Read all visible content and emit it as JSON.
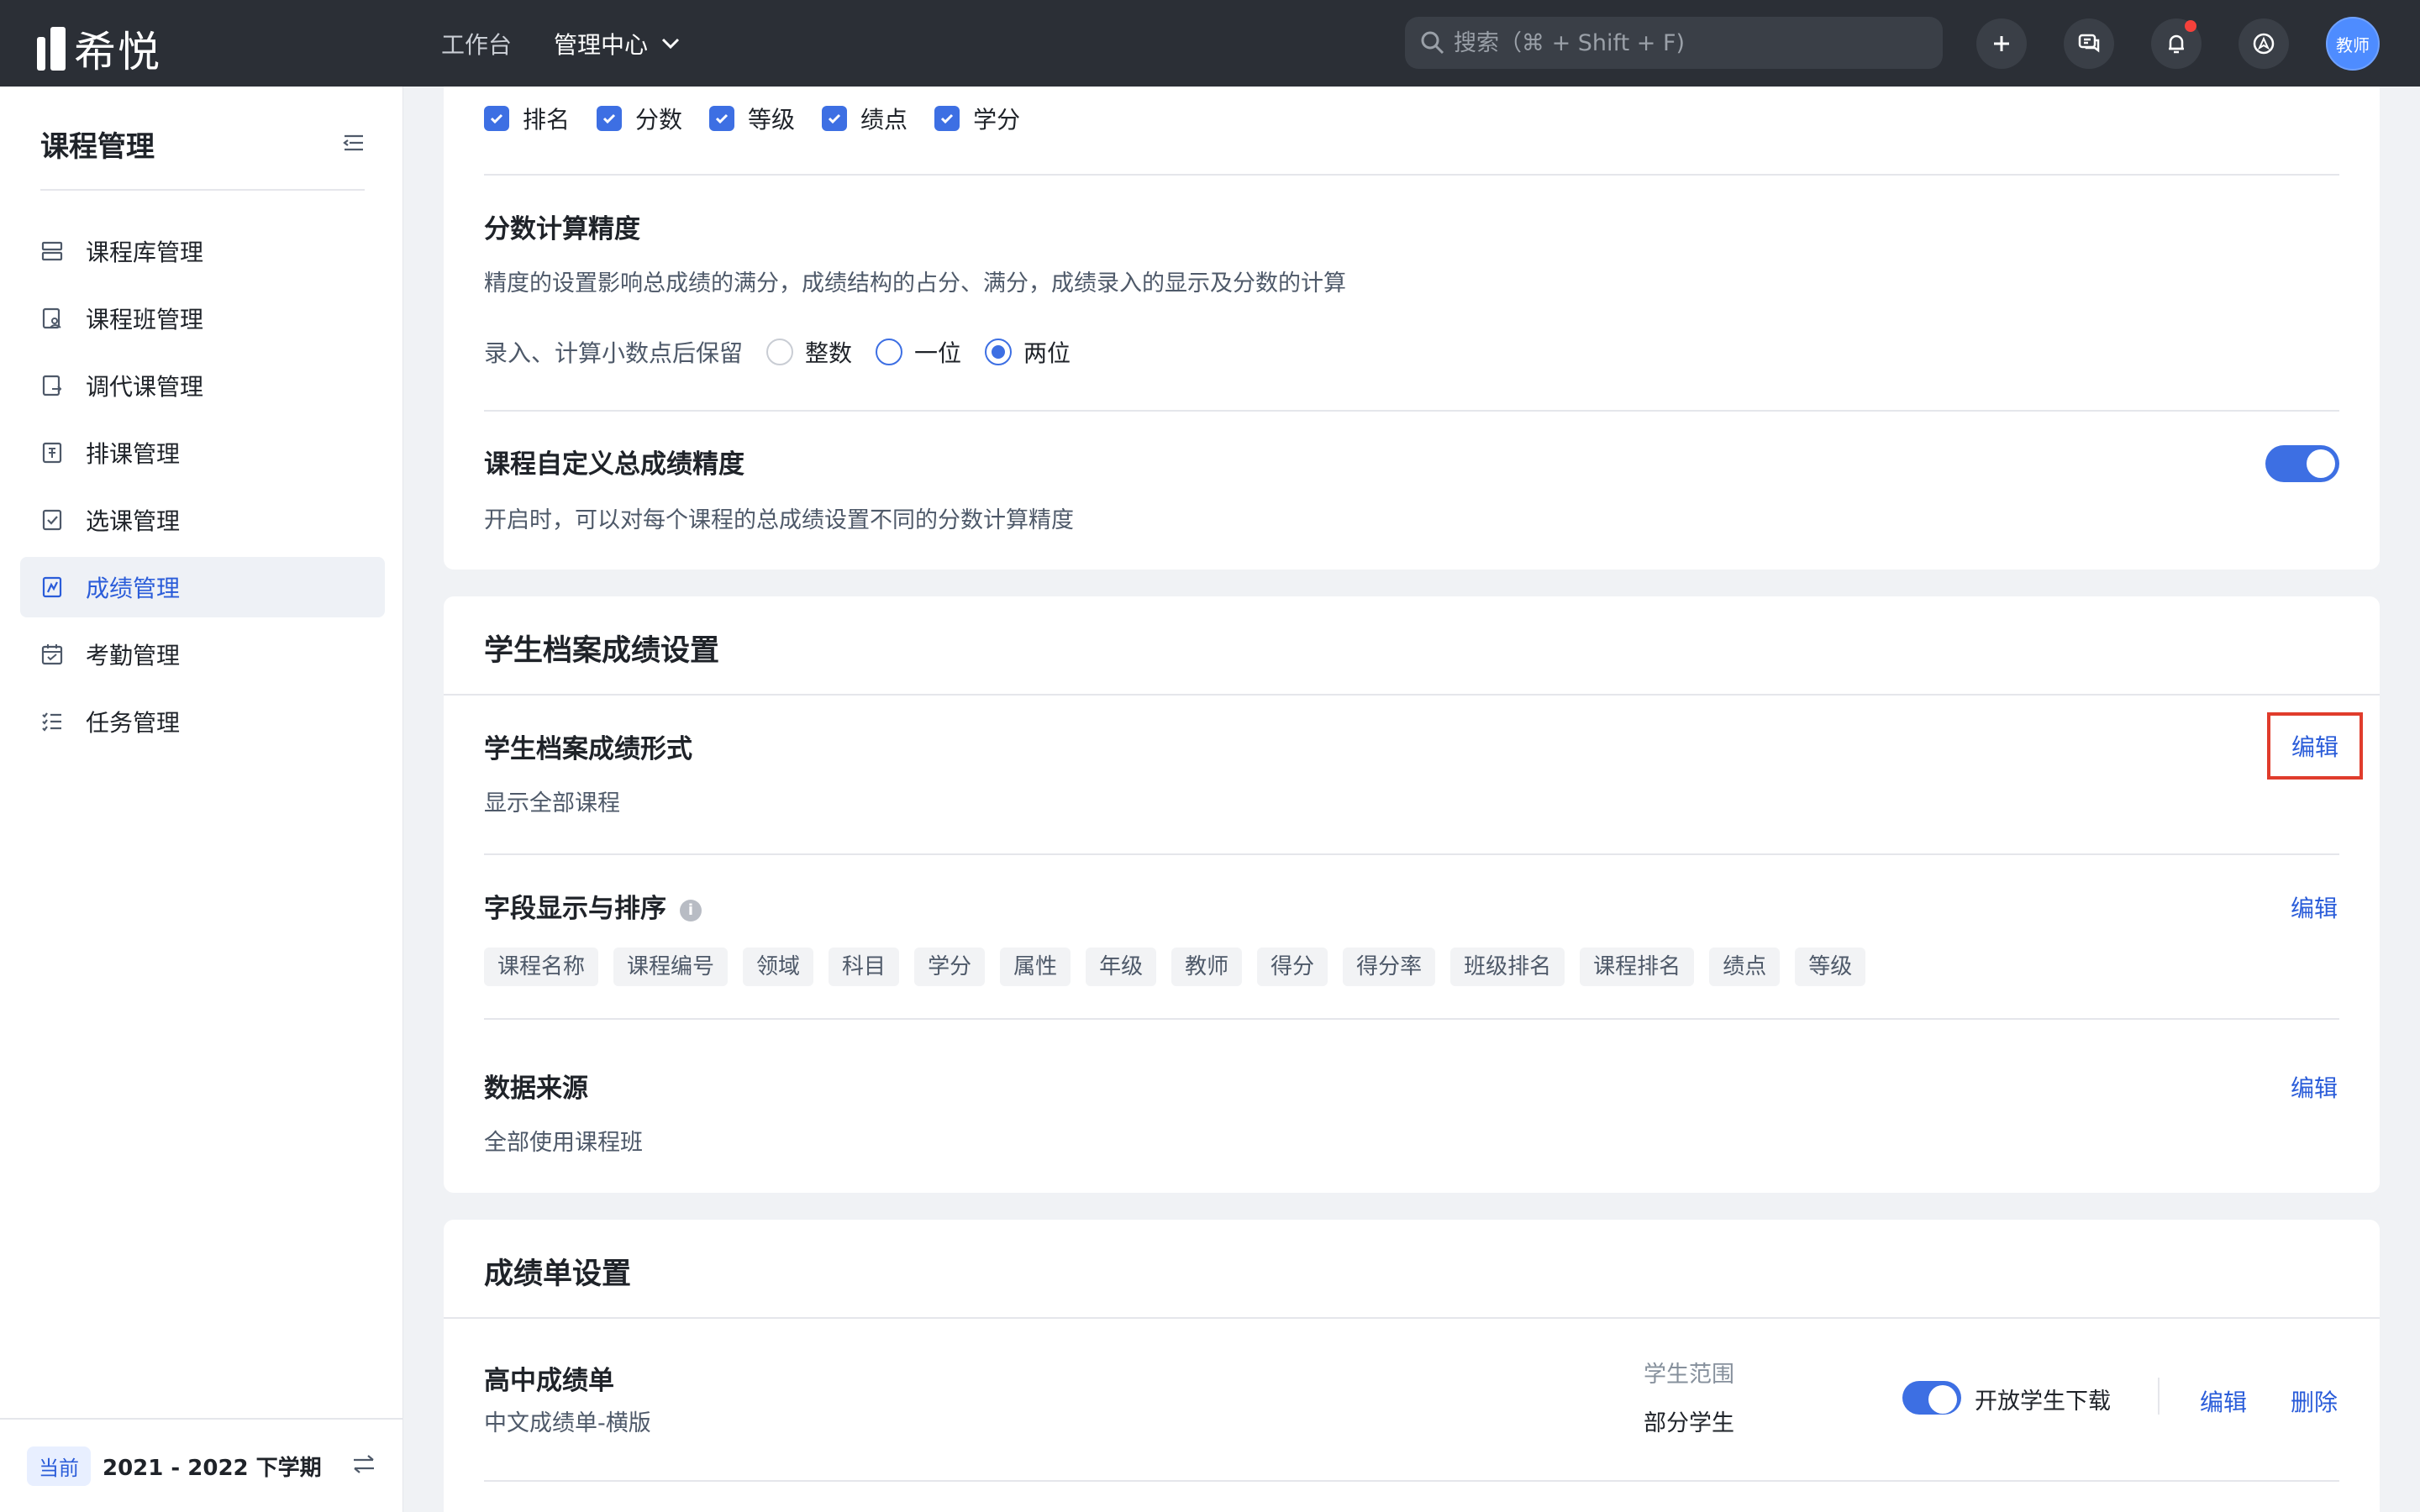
{
  "topbar": {
    "logo_text": "希悦",
    "nav": [
      {
        "label": "工作台"
      },
      {
        "label": "管理中心"
      }
    ],
    "search_placeholder": "搜索（⌘ + Shift + F)",
    "avatar_label": "教师"
  },
  "sidebar": {
    "title": "课程管理",
    "items": [
      {
        "label": "课程库管理",
        "icon": "course-library-icon"
      },
      {
        "label": "课程班管理",
        "icon": "course-class-icon"
      },
      {
        "label": "调代课管理",
        "icon": "substitute-icon"
      },
      {
        "label": "排课管理",
        "icon": "schedule-icon"
      },
      {
        "label": "选课管理",
        "icon": "course-selection-icon"
      },
      {
        "label": "成绩管理",
        "icon": "grades-icon",
        "active": true
      },
      {
        "label": "考勤管理",
        "icon": "attendance-icon"
      },
      {
        "label": "任务管理",
        "icon": "task-list-icon"
      }
    ],
    "footer": {
      "tag": "当前",
      "term": "2021 - 2022 下学期"
    }
  },
  "grade_fields": {
    "checkboxes": [
      {
        "label": "排名",
        "checked": true
      },
      {
        "label": "分数",
        "checked": true
      },
      {
        "label": "等级",
        "checked": true
      },
      {
        "label": "绩点",
        "checked": true
      },
      {
        "label": "学分",
        "checked": true
      }
    ]
  },
  "precision": {
    "title": "分数计算精度",
    "desc": "精度的设置影响总成绩的满分，成绩结构的占分、满分，成绩录入的显示及分数的计算",
    "radio_label": "录入、计算小数点后保留",
    "options": [
      {
        "label": "整数"
      },
      {
        "label": "一位"
      },
      {
        "label": "两位",
        "checked": true
      }
    ]
  },
  "custom_precision": {
    "title": "课程自定义总成绩精度",
    "desc": "开启时，可以对每个课程的总成绩设置不同的分数计算精度",
    "enabled": true
  },
  "archive": {
    "title": "学生档案成绩设置",
    "form": {
      "title": "学生档案成绩形式",
      "value": "显示全部课程",
      "edit": "编辑"
    },
    "fields": {
      "title": "字段显示与排序",
      "edit": "编辑",
      "tags": [
        "课程名称",
        "课程编号",
        "领域",
        "科目",
        "学分",
        "属性",
        "年级",
        "教师",
        "得分",
        "得分率",
        "班级排名",
        "课程排名",
        "绩点",
        "等级"
      ]
    },
    "source": {
      "title": "数据来源",
      "value": "全部使用课程班",
      "edit": "编辑"
    }
  },
  "report": {
    "title": "成绩单设置",
    "item": {
      "name": "高中成绩单",
      "subtitle": "中文成绩单-横版",
      "scope_label": "学生范围",
      "scope_value": "部分学生",
      "download_label": "开放学生下载",
      "download_enabled": true,
      "edit": "编辑",
      "delete": "删除"
    }
  },
  "colors": {
    "accent": "#3d6fe3",
    "link": "#2a5cd9",
    "highlight_box": "#e03c2c",
    "topbar": "#2b2f36"
  }
}
